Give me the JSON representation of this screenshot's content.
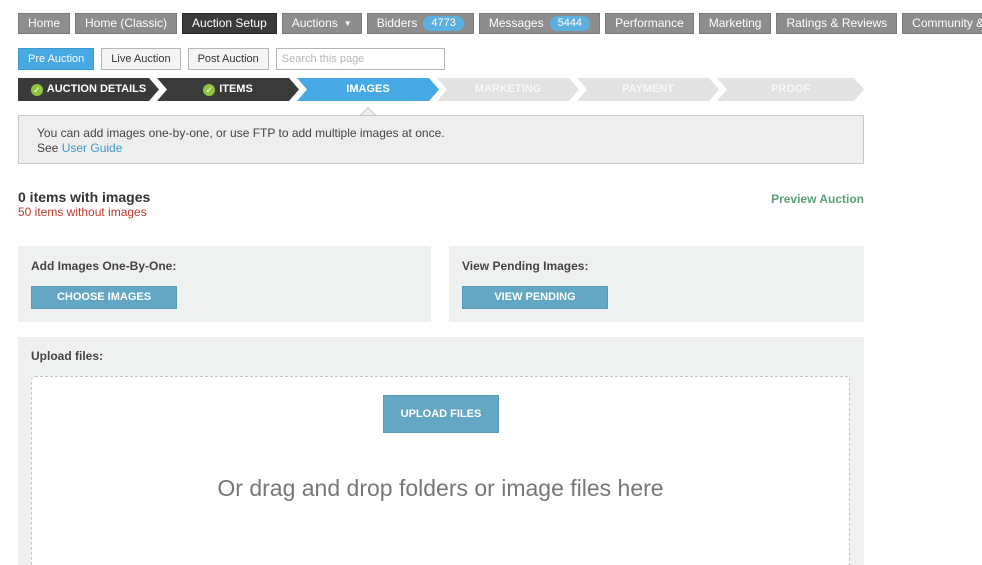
{
  "topnav": {
    "items": [
      {
        "label": "Home"
      },
      {
        "label": "Home (Classic)"
      },
      {
        "label": "Auction Setup"
      },
      {
        "label": "Auctions"
      },
      {
        "label": "Bidders",
        "badge": "4773"
      },
      {
        "label": "Messages",
        "badge": "5444"
      },
      {
        "label": "Performance"
      },
      {
        "label": "Marketing"
      },
      {
        "label": "Ratings & Reviews"
      },
      {
        "label": "Community & I"
      }
    ],
    "active": "Auction Setup"
  },
  "subnav": {
    "pre": "Pre Auction",
    "live": "Live Auction",
    "post": "Post Auction",
    "search_placeholder": "Search this page"
  },
  "steps": [
    {
      "label": "AUCTION DETAILS",
      "state": "done"
    },
    {
      "label": "ITEMS",
      "state": "done"
    },
    {
      "label": "IMAGES",
      "state": "current"
    },
    {
      "label": "MARKETING",
      "state": "todo"
    },
    {
      "label": "PAYMENT",
      "state": "todo"
    },
    {
      "label": "PROOF",
      "state": "todo"
    }
  ],
  "info": {
    "line1": "You can add images one-by-one, or use FTP to add multiple images at once.",
    "see": "See",
    "guide_link": "User Guide"
  },
  "counts": {
    "with_images": "0 items with images",
    "without_images": "50 items without images"
  },
  "preview_link": "Preview Auction",
  "add_panel": {
    "title": "Add Images One-By-One:",
    "button": "CHOOSE IMAGES"
  },
  "pending_panel": {
    "title": "View Pending Images:",
    "button": "VIEW PENDING"
  },
  "upload": {
    "title": "Upload files:",
    "button": "UPLOAD FILES",
    "drop_text": "Or drag and drop folders or image files here"
  },
  "colors": {
    "accent": "#46a9e3",
    "button": "#63a7c4",
    "done_step": "#3a3a3a",
    "check": "#8ec43e",
    "warning_text": "#c0392b"
  }
}
